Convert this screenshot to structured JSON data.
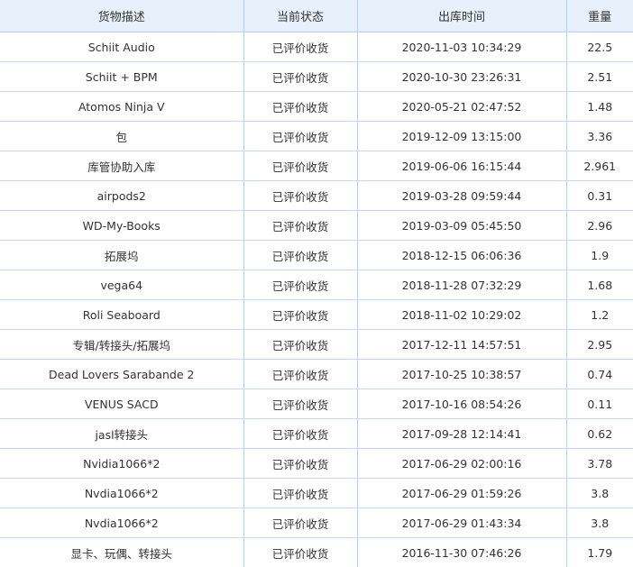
{
  "table": {
    "headers": [
      "货物描述",
      "当前状态",
      "出库时间",
      "重量"
    ],
    "rows": [
      {
        "desc": "Schiit Audio",
        "status": "已评价收货",
        "time": "2020-11-03 10:34:29",
        "weight": "22.5"
      },
      {
        "desc": "Schiit + BPM",
        "status": "已评价收货",
        "time": "2020-10-30 23:26:31",
        "weight": "2.51"
      },
      {
        "desc": "Atomos Ninja V",
        "status": "已评价收货",
        "time": "2020-05-21 02:47:52",
        "weight": "1.48"
      },
      {
        "desc": "包",
        "status": "已评价收货",
        "time": "2019-12-09 13:15:00",
        "weight": "3.36"
      },
      {
        "desc": "库管协助入库",
        "status": "已评价收货",
        "time": "2019-06-06 16:15:44",
        "weight": "2.961"
      },
      {
        "desc": "airpods2",
        "status": "已评价收货",
        "time": "2019-03-28 09:59:44",
        "weight": "0.31"
      },
      {
        "desc": "WD-My-Books",
        "status": "已评价收货",
        "time": "2019-03-09 05:45:50",
        "weight": "2.96"
      },
      {
        "desc": "拓展坞",
        "status": "已评价收货",
        "time": "2018-12-15 06:06:36",
        "weight": "1.9"
      },
      {
        "desc": "vega64",
        "status": "已评价收货",
        "time": "2018-11-28 07:32:29",
        "weight": "1.68"
      },
      {
        "desc": "Roli Seaboard",
        "status": "已评价收货",
        "time": "2018-11-02 10:29:02",
        "weight": "1.2"
      },
      {
        "desc": "专辑/转接头/拓展坞",
        "status": "已评价收货",
        "time": "2017-12-11 14:57:51",
        "weight": "2.95"
      },
      {
        "desc": "Dead Lovers Sarabande 2",
        "status": "已评价收货",
        "time": "2017-10-25 10:38:57",
        "weight": "0.74"
      },
      {
        "desc": "VENUS SACD",
        "status": "已评价收货",
        "time": "2017-10-16 08:54:26",
        "weight": "0.11"
      },
      {
        "desc": "jasl转接头",
        "status": "已评价收货",
        "time": "2017-09-28 12:14:41",
        "weight": "0.62"
      },
      {
        "desc": "Nvidia1066*2",
        "status": "已评价收货",
        "time": "2017-06-29 02:00:16",
        "weight": "3.78"
      },
      {
        "desc": "Nvdia1066*2",
        "status": "已评价收货",
        "time": "2017-06-29 01:59:26",
        "weight": "3.8"
      },
      {
        "desc": "Nvdia1066*2",
        "status": "已评价收货",
        "time": "2017-06-29 01:43:34",
        "weight": "3.8"
      },
      {
        "desc": "显卡、玩偶、转接头",
        "status": "已评价收货",
        "time": "2016-11-30 07:46:26",
        "weight": "1.79"
      }
    ]
  }
}
